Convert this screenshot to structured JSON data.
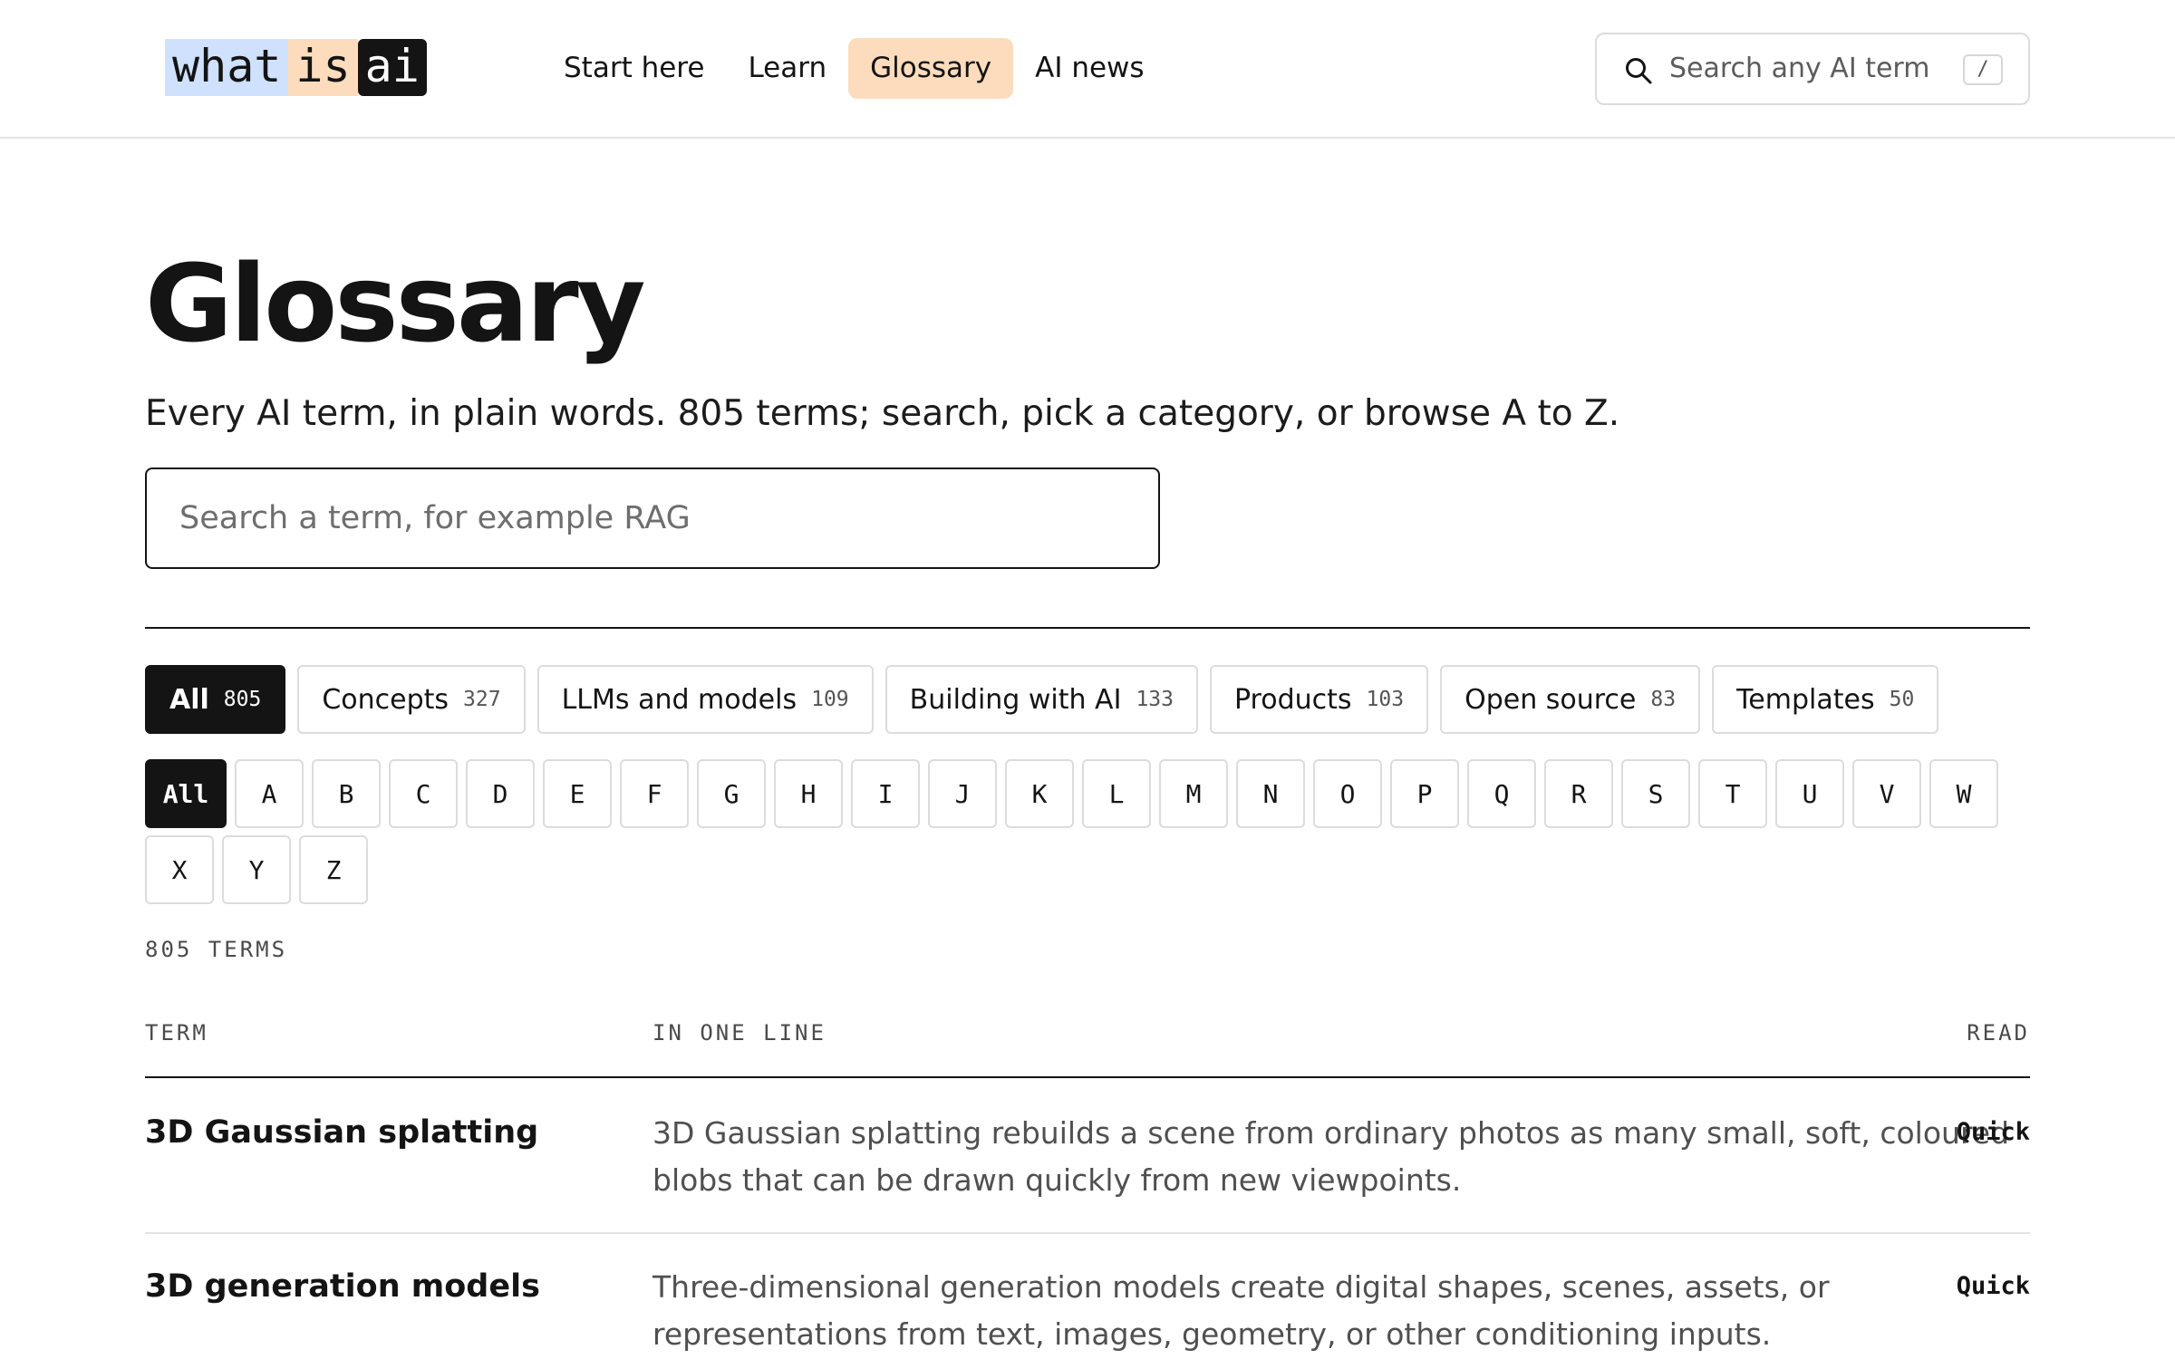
{
  "logo": {
    "part1": "what",
    "part2": "is",
    "part3": "ai"
  },
  "nav": {
    "items": [
      {
        "label": "Start here"
      },
      {
        "label": "Learn"
      },
      {
        "label": "Glossary"
      },
      {
        "label": "AI news"
      }
    ],
    "active": "Glossary"
  },
  "header_search": {
    "placeholder": "Search any AI term",
    "shortcut": "/"
  },
  "page": {
    "title": "Glossary",
    "subtitle": "Every AI term, in plain words. 805 terms; search, pick a category, or browse A to Z.",
    "search_placeholder": "Search a term, for example RAG"
  },
  "categories": [
    {
      "label": "All",
      "count": "805",
      "active": true
    },
    {
      "label": "Concepts",
      "count": "327"
    },
    {
      "label": "LLMs and models",
      "count": "109"
    },
    {
      "label": "Building with AI",
      "count": "133"
    },
    {
      "label": "Products",
      "count": "103"
    },
    {
      "label": "Open source",
      "count": "83"
    },
    {
      "label": "Templates",
      "count": "50"
    }
  ],
  "letters": [
    "All",
    "A",
    "B",
    "C",
    "D",
    "E",
    "F",
    "G",
    "H",
    "I",
    "J",
    "K",
    "L",
    "M",
    "N",
    "O",
    "P",
    "Q",
    "R",
    "S",
    "T",
    "U",
    "V",
    "W",
    "X",
    "Y",
    "Z"
  ],
  "results_count": "805 TERMS",
  "table": {
    "headers": {
      "term": "TERM",
      "line": "IN ONE LINE",
      "read": "READ"
    },
    "rows": [
      {
        "term": "3D Gaussian splatting",
        "line": "3D Gaussian splatting rebuilds a scene from ordinary photos as many small, soft, coloured blobs that can be drawn quickly from new viewpoints.",
        "read": "Quick"
      },
      {
        "term": "3D generation models",
        "line": "Three-dimensional generation models create digital shapes, scenes, assets, or representations from text, images, geometry, or other conditioning inputs.",
        "read": "Quick"
      }
    ]
  },
  "colors": {
    "accent_peach": "#fcdcbd",
    "accent_blue": "#cfe1fd",
    "ink": "#141414"
  }
}
